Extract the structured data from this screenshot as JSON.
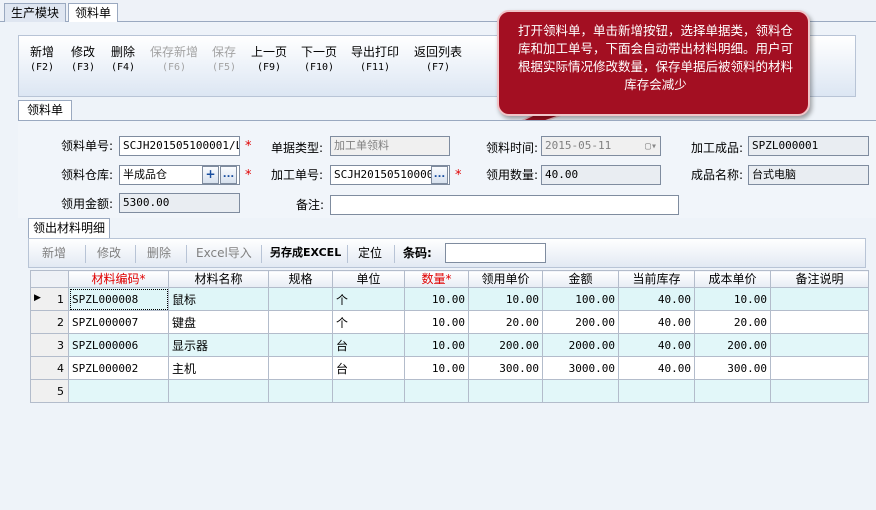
{
  "top_tabs": [
    "生产模块",
    "领料单"
  ],
  "toolbar": [
    {
      "label": "新增",
      "key": "(F2)",
      "enabled": true
    },
    {
      "label": "修改",
      "key": "(F3)",
      "enabled": true
    },
    {
      "label": "删除",
      "key": "(F4)",
      "enabled": true
    },
    {
      "label": "保存新增",
      "key": "(F6)",
      "enabled": false
    },
    {
      "label": "保存",
      "key": "(F5)",
      "enabled": false
    },
    {
      "label": "上一页",
      "key": "(F9)",
      "enabled": true
    },
    {
      "label": "下一页",
      "key": "(F10)",
      "enabled": true
    },
    {
      "label": "导出打印",
      "key": "(F11)",
      "enabled": true
    },
    {
      "label": "返回列表",
      "key": "(F7)",
      "enabled": true
    }
  ],
  "callout": {
    "text": "打开领料单，单击新增按钮，选择单据类，领料仓库和加工单号，下面会自动带出材料明细。用户可根据实际情况修改数量，保存单据后被领料的材料库存会减少"
  },
  "section_tab": "领料单",
  "form": {
    "order_no_label": "领料单号:",
    "order_no_value": "SCJH201505100001/LL(",
    "warehouse_label": "领料仓库:",
    "warehouse_value": "半成品仓",
    "amount_label": "领用金额:",
    "amount_value": "5300.00",
    "doc_type_label": "单据类型:",
    "doc_type_value": "加工单领料",
    "process_no_label": "加工单号:",
    "process_no_value": "SCJH201505100001/",
    "remark_label": "备注:",
    "remark_value": "",
    "pick_time_label": "领料时间:",
    "pick_time_value": "2015-05-11",
    "pick_qty_label": "领用数量:",
    "pick_qty_value": "40.00",
    "product_label": "加工成品:",
    "product_value": "SPZL000001",
    "product_name_label": "成品名称:",
    "product_name_value": "台式电脑",
    "add_btn": "+",
    "more_btn": "..."
  },
  "detail_tab": "领出材料明细",
  "detail_toolbar": {
    "add": "新增",
    "edit": "修改",
    "delete": "删除",
    "import": "Excel导入",
    "save_as": "另存成EXCEL",
    "locate": "定位",
    "barcode_label": "条码:",
    "barcode_value": ""
  },
  "grid": {
    "columns": [
      "材料编码*",
      "材料名称",
      "规格",
      "单位",
      "数量*",
      "领用单价",
      "金额",
      "当前库存",
      "成本单价",
      "备注说明"
    ],
    "rows": [
      {
        "no": "1",
        "code": "SPZL000008",
        "name": "鼠标",
        "spec": "",
        "unit": "个",
        "qty": "10.00",
        "price": "10.00",
        "amount": "100.00",
        "stock": "40.00",
        "cost": "10.00",
        "remark": ""
      },
      {
        "no": "2",
        "code": "SPZL000007",
        "name": "键盘",
        "spec": "",
        "unit": "个",
        "qty": "10.00",
        "price": "20.00",
        "amount": "200.00",
        "stock": "40.00",
        "cost": "20.00",
        "remark": ""
      },
      {
        "no": "3",
        "code": "SPZL000006",
        "name": "显示器",
        "spec": "",
        "unit": "台",
        "qty": "10.00",
        "price": "200.00",
        "amount": "2000.00",
        "stock": "40.00",
        "cost": "200.00",
        "remark": ""
      },
      {
        "no": "4",
        "code": "SPZL000002",
        "name": "主机",
        "spec": "",
        "unit": "台",
        "qty": "10.00",
        "price": "300.00",
        "amount": "3000.00",
        "stock": "40.00",
        "cost": "300.00",
        "remark": ""
      },
      {
        "no": "5",
        "code": "",
        "name": "",
        "spec": "",
        "unit": "",
        "qty": "",
        "price": "",
        "amount": "",
        "stock": "",
        "cost": "",
        "remark": ""
      }
    ]
  }
}
